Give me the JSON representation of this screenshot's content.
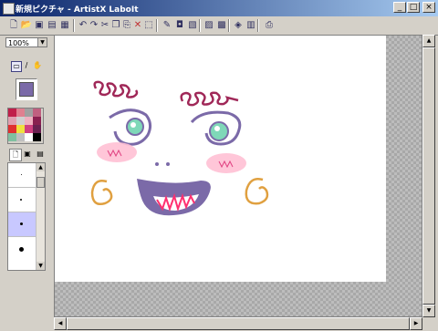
{
  "window": {
    "title": "新規ピクチャ - ArtistX LaboIt",
    "minimize": "_",
    "maximize": "□",
    "close": "×"
  },
  "toolbar": {
    "icons": [
      "new-icon",
      "open-icon",
      "save-icon",
      "save-as-icon",
      "print-icon",
      "undo-icon",
      "redo-icon",
      "cut-icon",
      "copy-icon",
      "paste-icon",
      "delete-icon",
      "select-all-icon",
      "pen-icon",
      "fill-icon",
      "layer-icon",
      "layer-options-icon",
      "filter-icon",
      "view-icon",
      "export-icon"
    ]
  },
  "left_panel": {
    "zoom_value": "100%",
    "current_color": "#7b6aa8",
    "palette": [
      "#c0204a",
      "#e08090",
      "#a0a0a0",
      "#c06080",
      "#e0a0b0",
      "#d0d0d0",
      "#f0b0c0",
      "#8a2050",
      "#e03030",
      "#f0e040",
      "#d04080",
      "#6a2050",
      "#80c0a0",
      "#c0c0c0",
      "#ffffff",
      "#000000"
    ]
  },
  "colors": {
    "paper": "#ffffff",
    "face_outline": "#7b6aa8",
    "hair": "#a02858",
    "cheeks": "#ff8ab0",
    "ears": "#e0a040",
    "pupil": "#3fb0a0",
    "tongue": "#ff3070"
  }
}
